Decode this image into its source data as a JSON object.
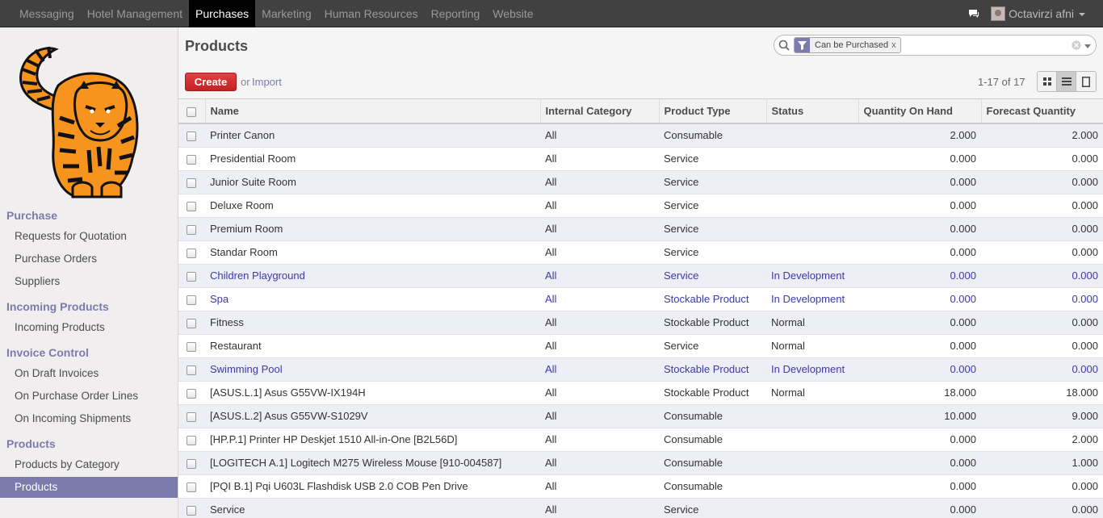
{
  "topnav": {
    "items": [
      "Messaging",
      "Hotel Management",
      "Purchases",
      "Marketing",
      "Human Resources",
      "Reporting",
      "Website"
    ],
    "active_index": 2
  },
  "user": {
    "name": "Octavirzi afni"
  },
  "sidebar": {
    "sections": [
      {
        "title": "Purchase",
        "items": [
          "Requests for Quotation",
          "Purchase Orders",
          "Suppliers"
        ]
      },
      {
        "title": "Incoming Products",
        "items": [
          "Incoming Products"
        ]
      },
      {
        "title": "Invoice Control",
        "items": [
          "On Draft Invoices",
          "On Purchase Order Lines",
          "On Incoming Shipments"
        ]
      },
      {
        "title": "Products",
        "items": [
          "Products by Category",
          "Products"
        ]
      }
    ],
    "active_item": "Products"
  },
  "header": {
    "title": "Products",
    "create_label": "Create",
    "or_label": "or",
    "import_label": "Import",
    "pager": "1-17 of 17"
  },
  "search": {
    "facet_label": "Can be Purchased",
    "facet_remove": "x"
  },
  "table": {
    "columns": [
      "Name",
      "Internal Category",
      "Product Type",
      "Status",
      "Quantity On Hand",
      "Forecast Quantity"
    ],
    "rows": [
      {
        "name": "Printer Canon",
        "category": "All",
        "type": "Consumable",
        "status": "",
        "on_hand": "2.000",
        "forecast": "2.000"
      },
      {
        "name": "Presidential Room",
        "category": "All",
        "type": "Service",
        "status": "",
        "on_hand": "0.000",
        "forecast": "0.000"
      },
      {
        "name": "Junior Suite Room",
        "category": "All",
        "type": "Service",
        "status": "",
        "on_hand": "0.000",
        "forecast": "0.000"
      },
      {
        "name": "Deluxe Room",
        "category": "All",
        "type": "Service",
        "status": "",
        "on_hand": "0.000",
        "forecast": "0.000"
      },
      {
        "name": "Premium Room",
        "category": "All",
        "type": "Service",
        "status": "",
        "on_hand": "0.000",
        "forecast": "0.000"
      },
      {
        "name": "Standar Room",
        "category": "All",
        "type": "Service",
        "status": "",
        "on_hand": "0.000",
        "forecast": "0.000"
      },
      {
        "name": "Children Playground",
        "category": "All",
        "type": "Service",
        "status": "In Development",
        "on_hand": "0.000",
        "forecast": "0.000"
      },
      {
        "name": "Spa",
        "category": "All",
        "type": "Stockable Product",
        "status": "In Development",
        "on_hand": "0.000",
        "forecast": "0.000"
      },
      {
        "name": "Fitness",
        "category": "All",
        "type": "Stockable Product",
        "status": "Normal",
        "on_hand": "0.000",
        "forecast": "0.000"
      },
      {
        "name": "Restaurant",
        "category": "All",
        "type": "Service",
        "status": "Normal",
        "on_hand": "0.000",
        "forecast": "0.000"
      },
      {
        "name": "Swimming Pool",
        "category": "All",
        "type": "Stockable Product",
        "status": "In Development",
        "on_hand": "0.000",
        "forecast": "0.000"
      },
      {
        "name": "[ASUS.L.1] Asus G55VW-IX194H",
        "category": "All",
        "type": "Stockable Product",
        "status": "Normal",
        "on_hand": "18.000",
        "forecast": "18.000"
      },
      {
        "name": "[ASUS.L.2] Asus G55VW-S1029V",
        "category": "All",
        "type": "Consumable",
        "status": "",
        "on_hand": "10.000",
        "forecast": "9.000"
      },
      {
        "name": "[HP.P.1] Printer HP Deskjet 1510 All-in-One [B2L56D]",
        "category": "All",
        "type": "Consumable",
        "status": "",
        "on_hand": "0.000",
        "forecast": "2.000"
      },
      {
        "name": "[LOGITECH A.1] Logitech M275 Wireless Mouse [910-004587]",
        "category": "All",
        "type": "Consumable",
        "status": "",
        "on_hand": "0.000",
        "forecast": "1.000"
      },
      {
        "name": "[PQI B.1] Pqi U603L Flashdisk USB 2.0 COB Pen Drive",
        "category": "All",
        "type": "Consumable",
        "status": "",
        "on_hand": "0.000",
        "forecast": "0.000"
      },
      {
        "name": "Service",
        "category": "All",
        "type": "Service",
        "status": "",
        "on_hand": "0.000",
        "forecast": "0.000"
      }
    ]
  },
  "colors": {
    "accent": "#7c7bad",
    "create_button": "#dc3333",
    "in_development_text": "#3a3aa8",
    "topbar": "#414141"
  },
  "icons": [
    "chat-icon",
    "search-icon",
    "filter-icon",
    "clear-icon",
    "kanban-view-icon",
    "list-view-icon",
    "form-view-icon",
    "tiger-logo"
  ]
}
